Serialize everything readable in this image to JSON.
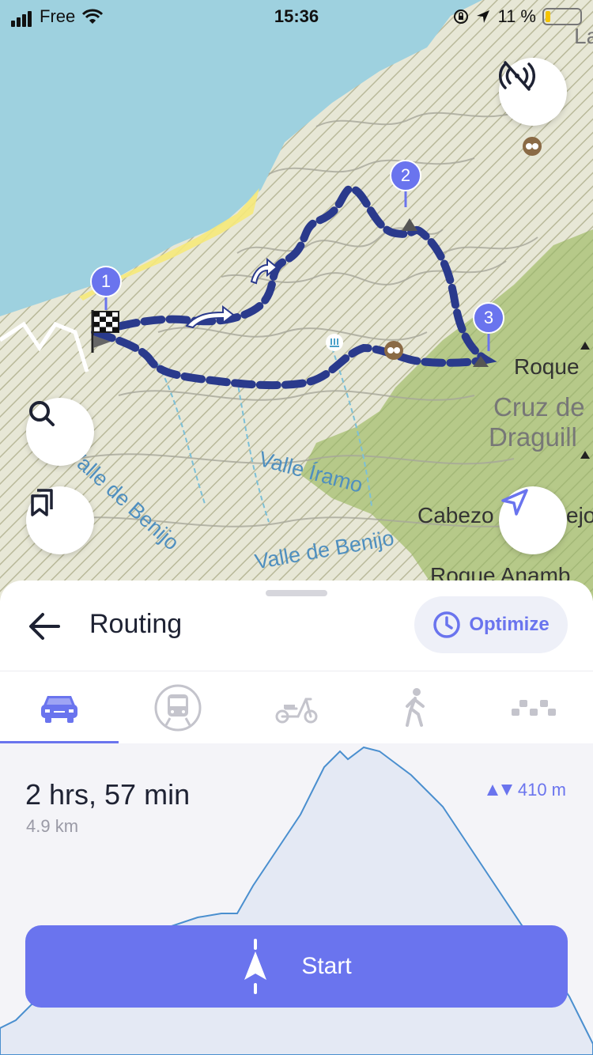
{
  "status_bar": {
    "carrier": "Free",
    "time": "15:36",
    "battery_percent": "11 %",
    "battery_level": 0.11
  },
  "map": {
    "labels": {
      "valle_benijo_1": "Valle de Benijo",
      "valle_iramo": "Valle Íramo",
      "valle_benijo_2": "Valle de Benijo",
      "roque": "Roque",
      "cruz_1": "Cruz de",
      "cruz_2": "Draguill",
      "cabezo": "Cabezo",
      "cabezo_right": "ejo",
      "roque_anamb": "Roque Anamb",
      "corner": "La"
    },
    "waypoints": [
      "1",
      "2",
      "3"
    ],
    "buttons": {
      "offline": "no-signal-icon",
      "search": "search-icon",
      "bookmarks": "bookmarks-icon",
      "locate": "locate-arrow-icon"
    }
  },
  "sheet": {
    "title": "Routing",
    "optimize_label": "Optimize",
    "tabs": [
      {
        "name": "car",
        "icon": "car-icon",
        "active": true
      },
      {
        "name": "transit",
        "icon": "train-icon",
        "active": false
      },
      {
        "name": "scooter",
        "icon": "scooter-icon",
        "active": false
      },
      {
        "name": "walk",
        "icon": "walking-icon",
        "active": false
      },
      {
        "name": "taxi",
        "icon": "taxi-icon",
        "active": false
      }
    ],
    "duration": "2 hrs, 57 min",
    "distance": "4.9 km",
    "elevation": "410 m",
    "start_label": "Start"
  },
  "colors": {
    "accent": "#6a74ee",
    "route": "#2a3a8c",
    "sea": "#9dd0e0",
    "land": "#e6e6d6",
    "forest": "#b7c98a"
  }
}
